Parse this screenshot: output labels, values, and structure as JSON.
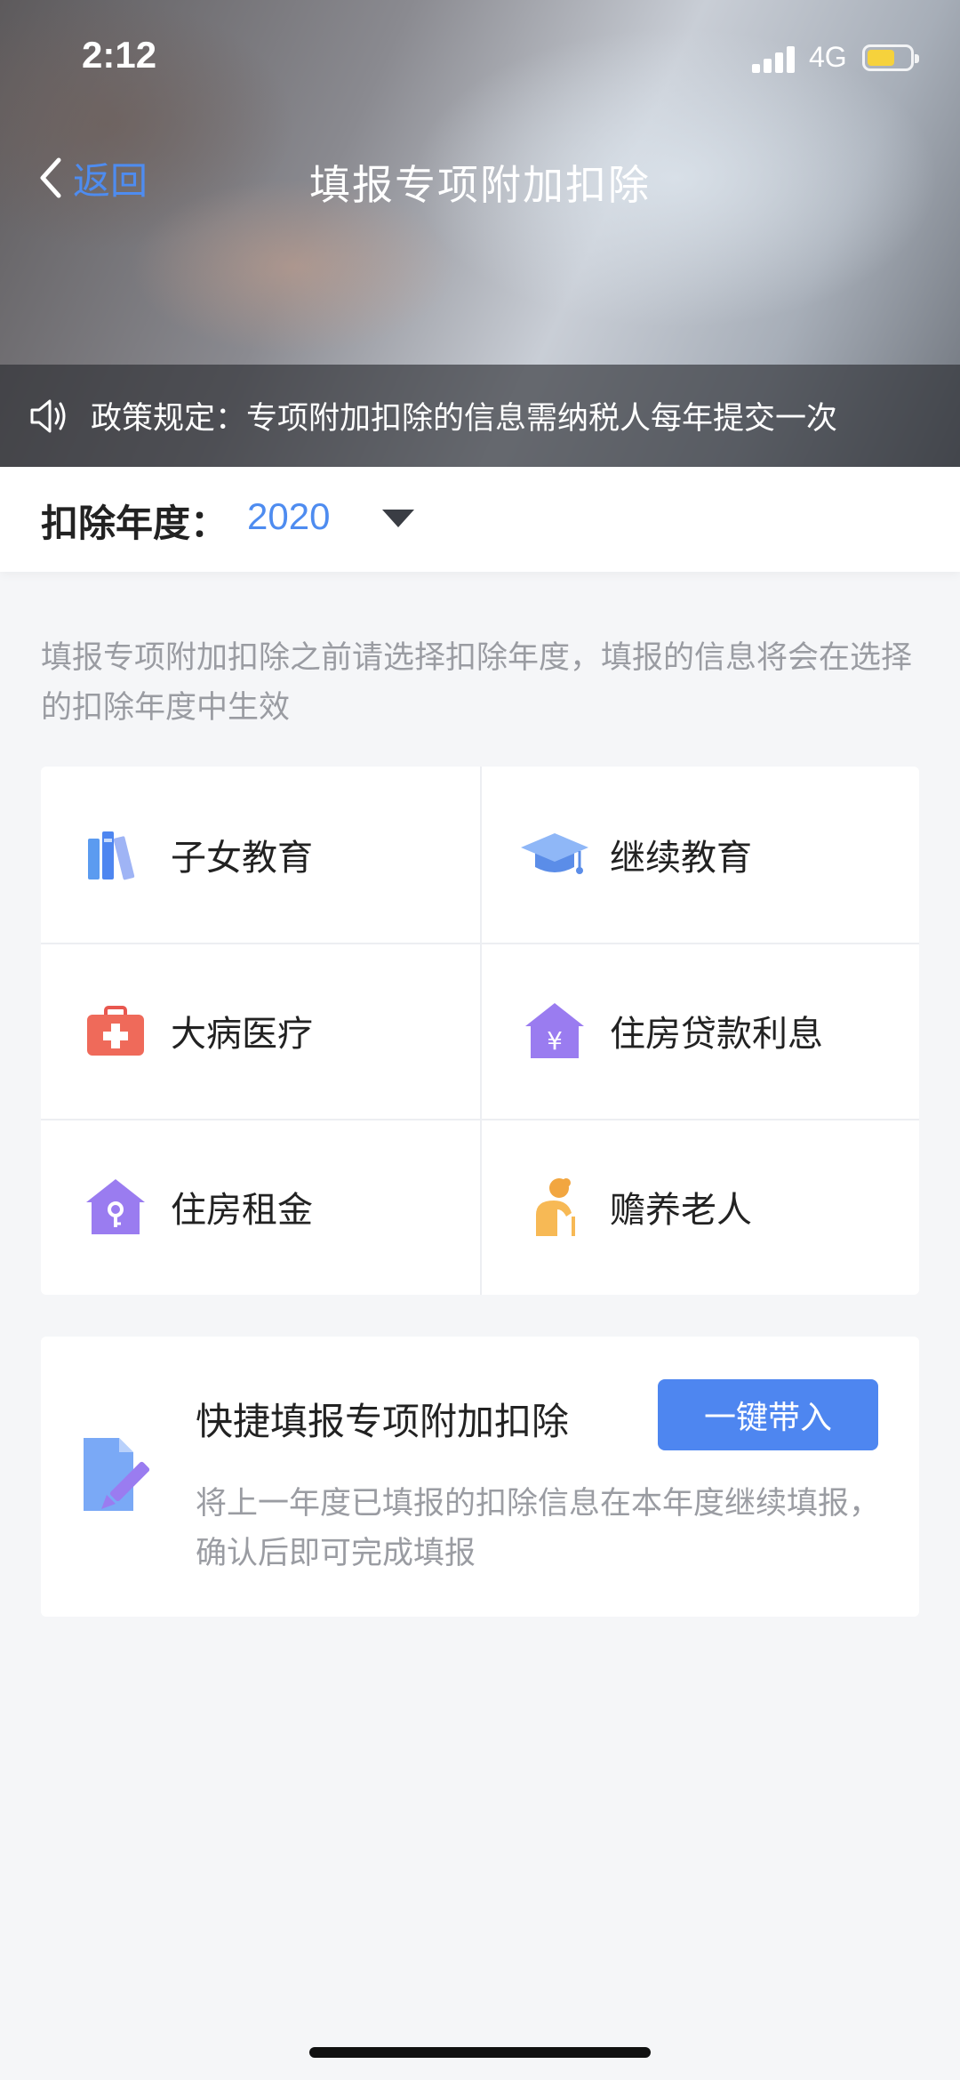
{
  "status_bar": {
    "time": "2:12",
    "network": "4G",
    "battery_color": "#f6d23c"
  },
  "nav": {
    "back_label": "返回",
    "title": "填报专项附加扣除"
  },
  "notice": {
    "icon": "speaker-icon",
    "text": "政策规定：专项附加扣除的信息需纳税人每年提交一次"
  },
  "year": {
    "label": "扣除年度：",
    "value": "2020"
  },
  "hint": "填报专项附加扣除之前请选择扣除年度，填报的信息将会在选择的扣除年度中生效",
  "categories": [
    {
      "label": "子女教育",
      "icon": "books-icon"
    },
    {
      "label": "继续教育",
      "icon": "graduation-cap-icon"
    },
    {
      "label": "大病医疗",
      "icon": "medical-kit-icon"
    },
    {
      "label": "住房贷款利息",
      "icon": "house-yuan-icon"
    },
    {
      "label": "住房租金",
      "icon": "house-key-icon"
    },
    {
      "label": "赡养老人",
      "icon": "elderly-person-icon"
    }
  ],
  "quick": {
    "icon": "document-pen-icon",
    "title": "快捷填报专项附加扣除",
    "button": "一键带入",
    "desc": "将上一年度已填报的扣除信息在本年度继续填报，确认后即可完成填报"
  },
  "colors": {
    "accent": "#4e86f0",
    "link": "#4e8cf0"
  }
}
